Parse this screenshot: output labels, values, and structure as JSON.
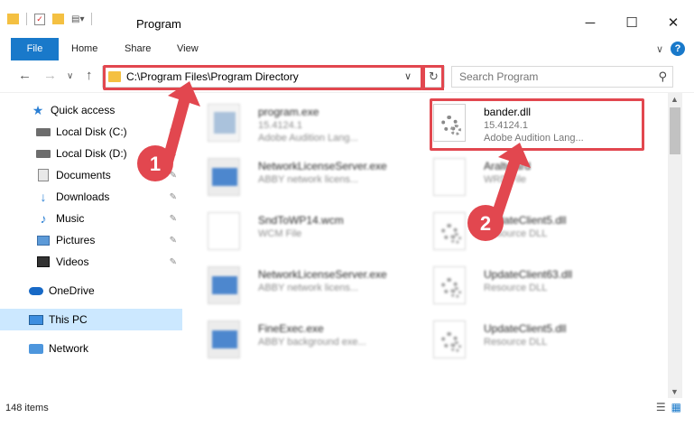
{
  "window": {
    "title": "Program",
    "minimize_glyph": "─",
    "maximize_glyph": "☐",
    "close_glyph": "✕"
  },
  "ribbon": {
    "tabs": [
      "File",
      "Home",
      "Share",
      "View"
    ],
    "help_glyph": "?",
    "collapse_glyph": "∨"
  },
  "address": {
    "path": "C:\\Program Files\\Program Directory",
    "dropdown_glyph": "∨",
    "refresh_glyph": "↻",
    "back_glyph": "←",
    "forward_glyph": "→",
    "recent_glyph": "∨",
    "up_glyph": "↑"
  },
  "search": {
    "placeholder": "Search Program",
    "icon_glyph": "⚲"
  },
  "sidebar": {
    "items": [
      {
        "label": "Quick access",
        "icon": "star-icon"
      },
      {
        "label": "Local Disk (C:)",
        "icon": "drive-icon"
      },
      {
        "label": "Local Disk (D:)",
        "icon": "drive-icon"
      },
      {
        "label": "Documents",
        "icon": "document-icon"
      },
      {
        "label": "Downloads",
        "icon": "download-icon"
      },
      {
        "label": "Music",
        "icon": "music-icon"
      },
      {
        "label": "Pictures",
        "icon": "pictures-icon"
      },
      {
        "label": "Videos",
        "icon": "videos-icon"
      },
      {
        "label": "OneDrive",
        "icon": "cloud-icon"
      },
      {
        "label": "This PC",
        "icon": "computer-icon"
      },
      {
        "label": "Network",
        "icon": "network-icon"
      }
    ],
    "pin_glyph": "✎"
  },
  "files": [
    {
      "name": "program.exe",
      "line1": "15.4124.1",
      "line2": "Adobe Audition Lang..."
    },
    {
      "name": "bander.dll",
      "line1": "15.4124.1",
      "line2": "Adobe Audition Lang..."
    },
    {
      "name": "NetworkLicenseServer.exe",
      "line1": "ABBY network licens...",
      "line2": ""
    },
    {
      "name": "Aralte.ard",
      "line1": "WRD File",
      "line2": ""
    },
    {
      "name": "SndToWP14.wcm",
      "line1": "WCM File",
      "line2": ""
    },
    {
      "name": "UpdateClient5.dll",
      "line1": "Resource DLL",
      "line2": ""
    },
    {
      "name": "NetworkLicenseServer.exe",
      "line1": "ABBY network licens...",
      "line2": ""
    },
    {
      "name": "UpdateClient63.dll",
      "line1": "Resource DLL",
      "line2": ""
    },
    {
      "name": "FineExec.exe",
      "line1": "ABBY background exe...",
      "line2": ""
    },
    {
      "name": "UpdateClient5.dll",
      "line1": "Resource DLL",
      "line2": ""
    }
  ],
  "status": {
    "item_count": "148 items"
  },
  "annotations": {
    "step1": "1",
    "step2": "2",
    "color": "#e2474f"
  }
}
